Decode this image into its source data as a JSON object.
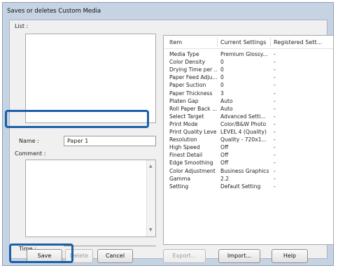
{
  "dialog": {
    "title": "Saves or deletes Custom Media",
    "list_label": "List :",
    "name_label": "Name :",
    "name_value": "Paper 1",
    "comment_label": "Comment :",
    "time_label": "Time :"
  },
  "settings_table": {
    "headers": [
      "Item",
      "Current Settings",
      "Registered Sett..."
    ],
    "rows": [
      [
        "Media Type",
        "Premium Glossy...",
        "-"
      ],
      [
        "Color Density",
        "0",
        "-"
      ],
      [
        "Drying Time per ...",
        "0",
        "-"
      ],
      [
        "Paper Feed Adju...",
        "0",
        "-"
      ],
      [
        "Paper Suction",
        "0",
        "-"
      ],
      [
        "Paper Thickness",
        "3",
        "-"
      ],
      [
        "Platen Gap",
        "Auto",
        "-"
      ],
      [
        "Roll Paper Back ...",
        "Auto",
        "-"
      ],
      [
        "Select Target",
        "Advanced Setti...",
        "-"
      ],
      [
        "Print Mode",
        "Color/B&W Photo",
        "-"
      ],
      [
        "Print Quality Level",
        "LEVEL 4 (Quality)",
        "-"
      ],
      [
        "Resolution",
        "Quality - 720x1...",
        "-"
      ],
      [
        "High Speed",
        "Off",
        "-"
      ],
      [
        "Finest Detail",
        "Off",
        "-"
      ],
      [
        "Edge Smoothing",
        "Off",
        "-"
      ],
      [
        "Color Adjustment",
        "Business Graphics",
        "-"
      ],
      [
        "Gamma",
        "2.2",
        "-"
      ],
      [
        "Setting",
        "Default Setting",
        "-"
      ]
    ]
  },
  "buttons": {
    "save": "Save",
    "delete": "Delete",
    "cancel": "Cancel",
    "export": "Export...",
    "import": "Import...",
    "help": "Help"
  },
  "colors": {
    "dialog_frame": "#c6d3e3",
    "client_bg": "#f0f0f0",
    "highlight": "#1b5fa8"
  }
}
